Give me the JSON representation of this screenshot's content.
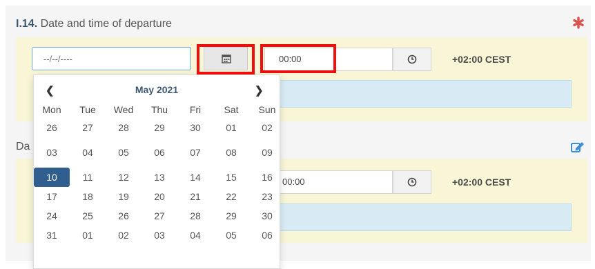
{
  "section1": {
    "code": "I.14.",
    "title": "Date and time of departure",
    "date_placeholder": "--/--/----",
    "time_value": "00:00",
    "timezone": "+02:00 CEST"
  },
  "section2": {
    "title_visible": "Da",
    "time_value": "00:00",
    "timezone": "+02:00 CEST"
  },
  "datepicker": {
    "month_year": "May 2021",
    "prev_label": "❮",
    "next_label": "❯",
    "weekdays": [
      "Mon",
      "Tue",
      "Wed",
      "Thu",
      "Fri",
      "Sat",
      "Sun"
    ],
    "weeks": [
      [
        "26",
        "27",
        "28",
        "29",
        "30",
        "01",
        "02"
      ],
      [
        "03",
        "04",
        "05",
        "06",
        "07",
        "08",
        "09"
      ],
      [
        "10",
        "11",
        "12",
        "13",
        "14",
        "15",
        "16"
      ],
      [
        "17",
        "18",
        "19",
        "20",
        "21",
        "22",
        "23"
      ],
      [
        "24",
        "25",
        "26",
        "27",
        "28",
        "29",
        "30"
      ],
      [
        "31",
        "01",
        "02",
        "03",
        "04",
        "05",
        "06"
      ]
    ],
    "selected_day": "10"
  },
  "colors": {
    "highlight_red": "#ee0f0f",
    "selected_blue": "#2f5e8f",
    "required_red": "#d9534f",
    "edit_blue": "#3a8fd6"
  },
  "icons": {
    "calendar": "calendar-icon",
    "clock": "clock-icon",
    "required": "asterisk-icon",
    "edit": "edit-icon"
  }
}
